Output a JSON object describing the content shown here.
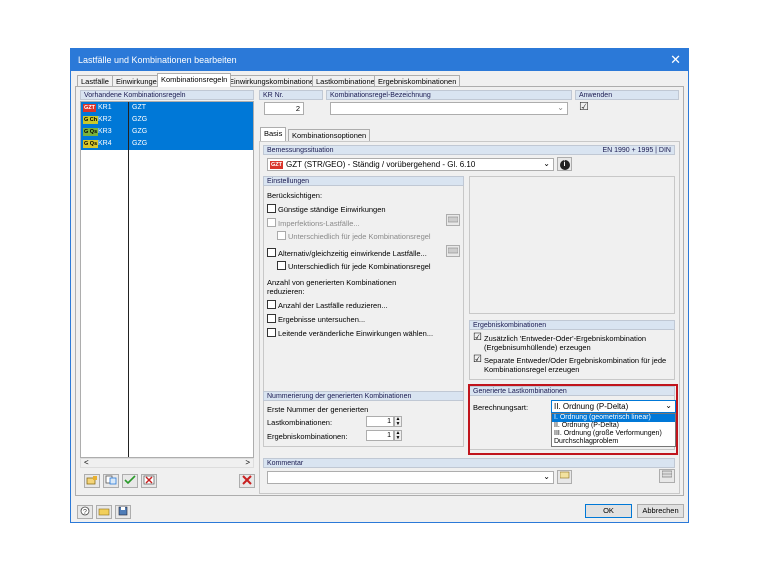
{
  "window": {
    "title": "Lastfälle und Kombinationen bearbeiten",
    "close": "✕"
  },
  "tabs": [
    "Lastfälle",
    "Einwirkungen",
    "Kombinationsregeln",
    "Einwirkungskombinationen",
    "Lastkombinationen",
    "Ergebniskombinationen"
  ],
  "left": {
    "header": "Vorhandene Kombinationsregeln",
    "rows": [
      {
        "badge": "GZT",
        "badge_color": "#d9342b",
        "id": "KR1",
        "type": "GZT"
      },
      {
        "badge": "G Ch",
        "badge_color": "#c9c92a",
        "id": "KR2",
        "type": "GZG"
      },
      {
        "badge": "G Qs",
        "badge_color": "#7bb23a",
        "id": "KR3",
        "type": "GZG"
      },
      {
        "badge": "G Qs",
        "badge_color": "#d9c62a",
        "id": "KR4",
        "type": "GZG"
      }
    ],
    "scroll_left": "<",
    "scroll_right": ">"
  },
  "top": {
    "kr_nr_label": "KR Nr.",
    "kr_nr_value": "2",
    "bezeichnung_label": "Kombinationsregel-Bezeichnung",
    "bezeichnung_value": "",
    "anwenden_label": "Anwenden",
    "anwenden_check": "☑"
  },
  "subtabs": [
    "Basis",
    "Kombinationsoptionen"
  ],
  "bemessung": {
    "label": "Bemessungssituation",
    "norm": "EN 1990 + 1995 | DIN",
    "badge": "GZT",
    "value": "GZT (STR/GEO) - Ständig / vorübergehend - Gl. 6.10",
    "info": "i"
  },
  "einstellungen": {
    "header": "Einstellungen",
    "beruecksichtigen": "Berücksichtigen:",
    "items": [
      "Günstige ständige Einwirkungen",
      "Imperfektions-Lastfälle...",
      "Unterschiedlich für jede Kombinationsregel",
      "Alternativ/gleichzeitig einwirkende Lastfälle...",
      "Unterschiedlich für jede Kombinationsregel"
    ],
    "anzahl_label_1": "Anzahl von generierten Kombinationen",
    "anzahl_label_2": "reduzieren:",
    "reduce_items": [
      "Anzahl der Lastfälle reduzieren...",
      "Ergebnisse untersuchen...",
      "Leitende veränderliche Einwirkungen wählen..."
    ]
  },
  "ergebnis": {
    "header": "Ergebniskombinationen",
    "item1_line1": "Zusätzlich 'Entweder-Oder'-Ergebniskombination",
    "item1_line2": "(Ergebnisumhüllende) erzeugen",
    "item2_line1": "Separate Entweder/Oder Ergebniskombination für jede",
    "item2_line2": "Kombinationsregel erzeugen"
  },
  "nummerierung": {
    "header": "Nummerierung der generierten Kombinationen",
    "label1": "Erste Nummer der generierten",
    "last_label": "Lastkombinationen:",
    "last_value": "1",
    "erg_label": "Ergebniskombinationen:",
    "erg_value": "1"
  },
  "generierte": {
    "header": "Generierte Lastkombinationen",
    "label": "Berechnungsart:",
    "selected": "II. Ordnung (P-Delta)",
    "options": [
      "I. Ordnung (geometrisch linear)",
      "II. Ordnung (P-Delta)",
      "III. Ordnung (große Verformungen)",
      "Durchschlagproblem"
    ]
  },
  "kommentar": {
    "label": "Kommentar",
    "value": ""
  },
  "buttons": {
    "ok": "OK",
    "cancel": "Abbrechen"
  },
  "colors": {
    "accent": "#2b79d8",
    "selection": "#0078d7",
    "highlight": "#c0141c"
  }
}
